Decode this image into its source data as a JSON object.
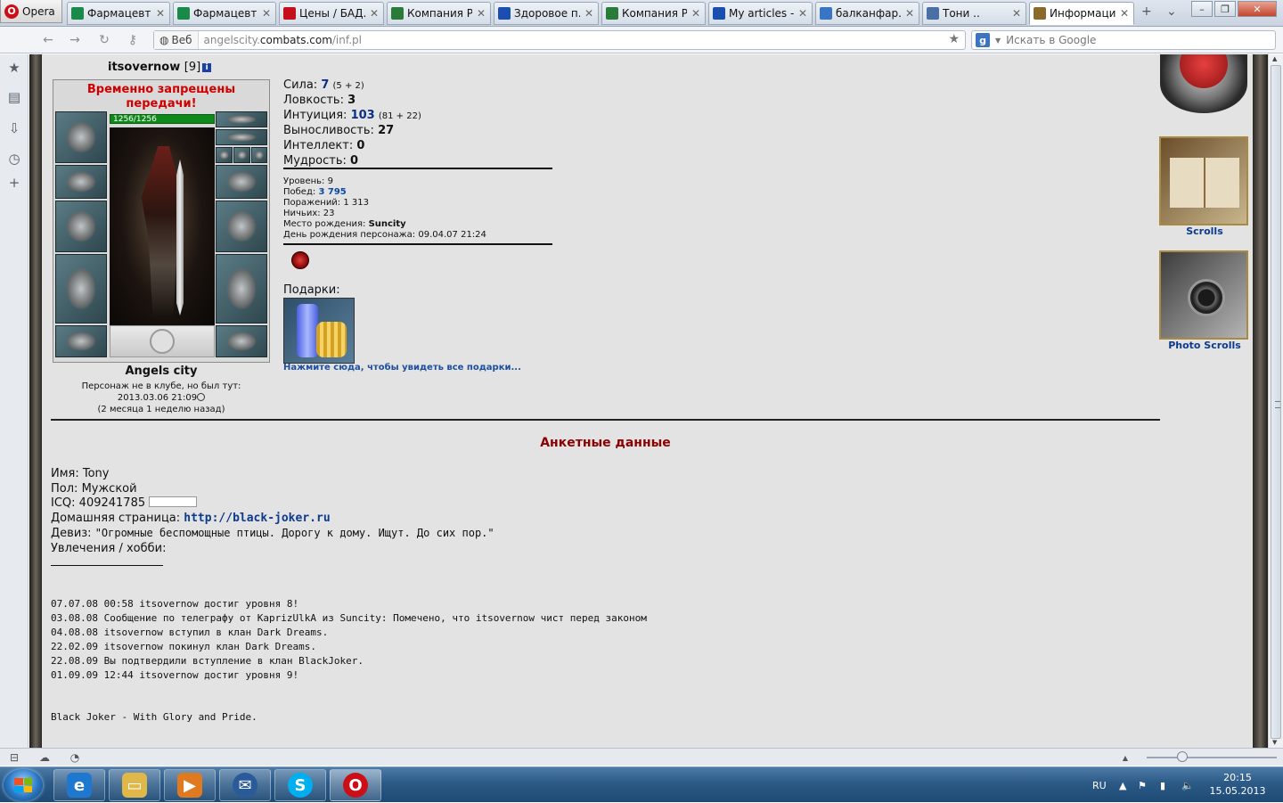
{
  "browser": {
    "menu_label": "Opera",
    "tabs": [
      {
        "title": "Фармацевти...",
        "color": "#1a8a4a"
      },
      {
        "title": "Фармацевти...",
        "color": "#1a8a4a"
      },
      {
        "title": "Цены / БАД...",
        "color": "#c4101a"
      },
      {
        "title": "Компания Р...",
        "color": "#2a7a3a"
      },
      {
        "title": "Здоровое п...",
        "color": "#1a4fb0"
      },
      {
        "title": "Компания Р...",
        "color": "#2a7a3a"
      },
      {
        "title": "My articles - ...",
        "color": "#1a4fb0"
      },
      {
        "title": "балканфар...",
        "color": "#3a75c4"
      },
      {
        "title": "Тони ..",
        "color": "#4a6fa5"
      },
      {
        "title": "Информаци...",
        "color": "#8a6a2a"
      }
    ],
    "web_badge": "Веб",
    "url_prefix": "angelscity.",
    "url_domain": "combats.com",
    "url_path": "/inf.pl",
    "search_placeholder": "Искать в Google"
  },
  "profile": {
    "username": "itsovernow",
    "level_bracket": "[9]",
    "ban_text": "Временно запрещены передачи!",
    "hp": "1256/1256",
    "city": "Angels city",
    "seen_line1": "Персонаж не в клубе, но был тут:",
    "seen_line2": "2013.03.06 21:09",
    "seen_line3": "(2 месяца 1 неделю назад)",
    "stats": [
      {
        "label": "Сила:",
        "value": "7",
        "extra": "(5 + 2)",
        "blue": true
      },
      {
        "label": "Ловкость:",
        "value": "3",
        "extra": "",
        "blue": false
      },
      {
        "label": "Интуиция:",
        "value": "103",
        "extra": "(81 + 22)",
        "blue": true
      },
      {
        "label": "Выносливость:",
        "value": "27",
        "extra": "",
        "blue": false
      },
      {
        "label": "Интеллект:",
        "value": "0",
        "extra": "",
        "blue": false
      },
      {
        "label": "Мудрость:",
        "value": "0",
        "extra": "",
        "blue": false
      }
    ],
    "level_label": "Уровень:",
    "level_value": "9",
    "wins_label": "Побед:",
    "wins_value": "3 795",
    "losses_label": "Поражений:",
    "losses_value": "1 313",
    "draws_label": "Ничьих:",
    "draws_value": "23",
    "birthplace_label": "Место рождения:",
    "birthplace_value": "Suncity",
    "birthday_label": "День рождения персонажа:",
    "birthday_value": "09.04.07 21:24",
    "gifts_label": "Подарки:",
    "gifts_link": "Нажмите сюда, чтобы увидеть все подарки..."
  },
  "anketa": {
    "title": "Анкетные данные",
    "name_label": "Имя:",
    "name_value": "Tony",
    "gender_label": "Пол:",
    "gender_value": "Мужской",
    "icq_label": "ICQ:",
    "icq_value": "409241785",
    "homepage_label": "Домашняя страница:",
    "homepage_value": "http://black-joker.ru",
    "motto_label": "Девиз:",
    "motto_value": "\"Огромные беспомощные птицы. Дорогу к дому. Ищут. До сих пор.\"",
    "hobby_label": "Увлечения / хобби:",
    "log": [
      "07.07.08 00:58 itsovernow достиг уровня 8!",
      "03.08.08 Сообщение по телеграфу от KaprizUlkA из Suncity: Помечено, что itsovernow чист перед законом",
      "04.08.08 itsovernow вступил в клан Dark Dreams.",
      "22.02.09 itsovernow покинул клан Dark Dreams.",
      "22.08.09 Вы подтвердили вступление в клан BlackJoker.",
      "01.09.09 12:44 itsovernow достиг уровня 9!"
    ],
    "signature": "Black Joker - With Glory and Pride."
  },
  "side_links": {
    "scrolls": "Scrolls",
    "photo_scrolls": "Photo Scrolls"
  },
  "taskbar": {
    "lang": "RU",
    "time": "20:15",
    "date": "15.05.2013"
  }
}
